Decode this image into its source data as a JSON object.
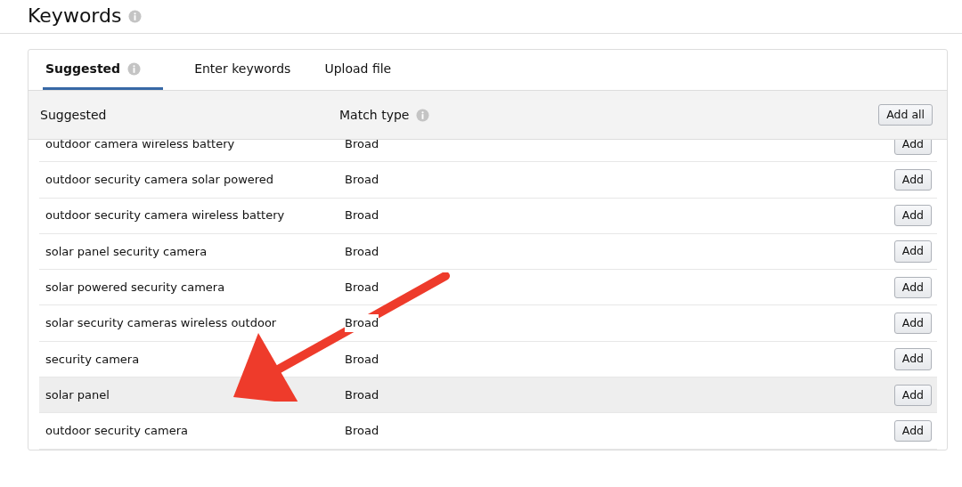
{
  "page": {
    "title": "Keywords"
  },
  "tabs": [
    {
      "label": "Suggested",
      "selected": true,
      "info": true
    },
    {
      "label": "Enter keywords",
      "selected": false,
      "info": false
    },
    {
      "label": "Upload file",
      "selected": false,
      "info": false
    }
  ],
  "table": {
    "columns": [
      "Suggested",
      "Match type"
    ],
    "add_all": "Add all",
    "rows": [
      {
        "keyword": "outdoor camera wireless battery",
        "match_type": "Broad",
        "action": "Add",
        "highlighted": false
      },
      {
        "keyword": "outdoor security camera solar powered",
        "match_type": "Broad",
        "action": "Add",
        "highlighted": false
      },
      {
        "keyword": "outdoor security camera wireless battery",
        "match_type": "Broad",
        "action": "Add",
        "highlighted": false
      },
      {
        "keyword": "solar panel security camera",
        "match_type": "Broad",
        "action": "Add",
        "highlighted": false
      },
      {
        "keyword": "solar powered security camera",
        "match_type": "Broad",
        "action": "Add",
        "highlighted": false
      },
      {
        "keyword": "solar security cameras wireless outdoor",
        "match_type": "Broad",
        "action": "Add",
        "highlighted": false
      },
      {
        "keyword": "security camera",
        "match_type": "Broad",
        "action": "Add",
        "highlighted": false
      },
      {
        "keyword": "solar panel",
        "match_type": "Broad",
        "action": "Add",
        "highlighted": true
      },
      {
        "keyword": "outdoor security camera",
        "match_type": "Broad",
        "action": "Add",
        "highlighted": false
      }
    ]
  }
}
